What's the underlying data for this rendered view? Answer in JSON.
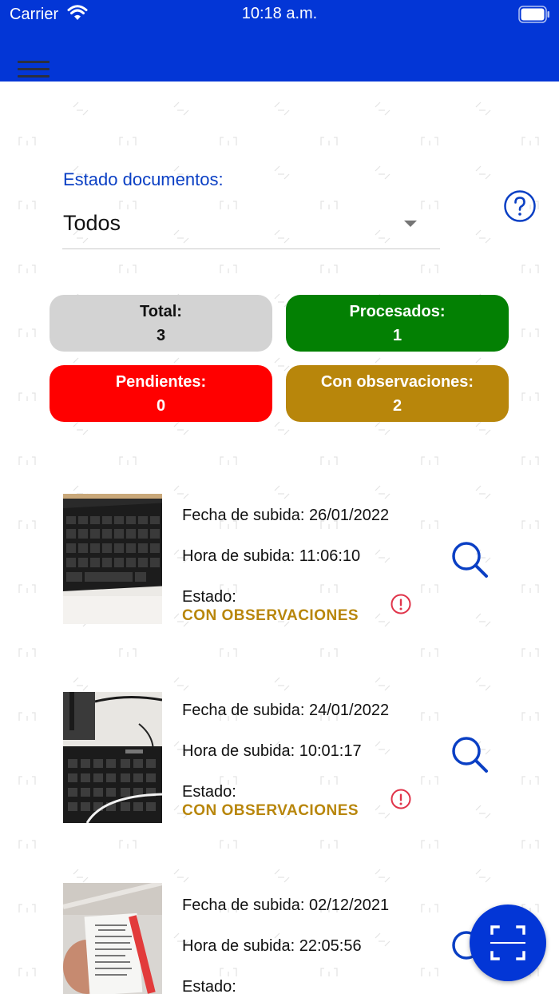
{
  "status_bar": {
    "carrier": "Carrier",
    "time": "10:18 a.m."
  },
  "filter": {
    "label": "Estado documentos:",
    "selected": "Todos"
  },
  "stats": {
    "total_label": "Total:",
    "total_value": "3",
    "processed_label": "Procesados:",
    "processed_value": "1",
    "pending_label": "Pendientes:",
    "pending_value": "0",
    "observed_label": "Con observaciones:",
    "observed_value": "2"
  },
  "documents": [
    {
      "upload_date": "Fecha de subida: 26/01/2022",
      "upload_time": "Hora de subida: 11:06:10",
      "status_label": "Estado:",
      "status_value": "CON OBSERVACIONES"
    },
    {
      "upload_date": "Fecha de subida: 24/01/2022",
      "upload_time": "Hora de subida: 10:01:17",
      "status_label": "Estado:",
      "status_value": "CON OBSERVACIONES"
    },
    {
      "upload_date": "Fecha de subida: 02/12/2021",
      "upload_time": "Hora de subida: 22:05:56",
      "status_label": "Estado:",
      "status_value": ""
    }
  ],
  "icons": {
    "menu": "hamburger-menu-icon",
    "help": "help-circle-icon",
    "warning": "alert-circle-icon",
    "view": "magnifier-icon",
    "scan": "document-scan-icon"
  },
  "colors": {
    "primary": "#0336d6",
    "processed": "#038003",
    "pending": "#ff0000",
    "observed": "#b8860b",
    "total": "#d3d3d3",
    "warning": "#e0344a"
  }
}
